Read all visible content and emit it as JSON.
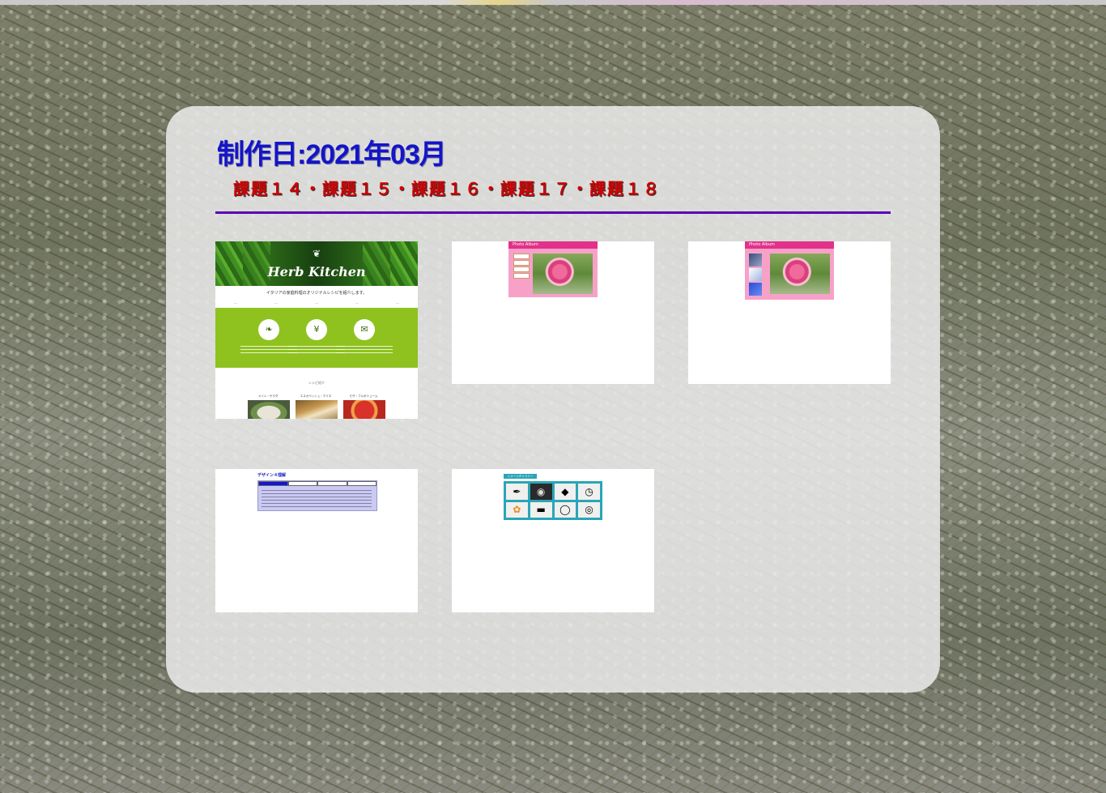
{
  "page": {
    "title": "制作日:2021年03月",
    "subtitle": "課題１４・課題１５・課題１６・課題１７・課題１８"
  },
  "colors": {
    "title": "#1414c8",
    "subtitle": "#d40000",
    "rule": "#5a00b4",
    "panel": "#ebebeb"
  },
  "thumbnails": [
    {
      "name": "herb-kitchen",
      "logo": "Herb Kitchen",
      "tagline": "イタリアの家庭料理のオリジナルレシピを紹介します。",
      "section": "レシピ紹介",
      "captions": [
        "メイン・サラダ",
        "エスカベッシュ・マリネ",
        "ピザ・フルボリューム"
      ],
      "icons": [
        "leaf-icon",
        "utensils-icon",
        "envelope-icon"
      ]
    },
    {
      "name": "photo-album-1",
      "heading": "Photo Album"
    },
    {
      "name": "photo-album-2",
      "heading": "Photo Album"
    },
    {
      "name": "design-4",
      "heading": "デザイン４理解"
    },
    {
      "name": "image-gallery",
      "heading": "イメージギャラリー",
      "icons": [
        "feather-icon",
        "watch-icon",
        "pinecone-icon",
        "clock-icon",
        "flower-icon",
        "knife-icon",
        "ring-icon",
        "compass-icon"
      ]
    }
  ]
}
